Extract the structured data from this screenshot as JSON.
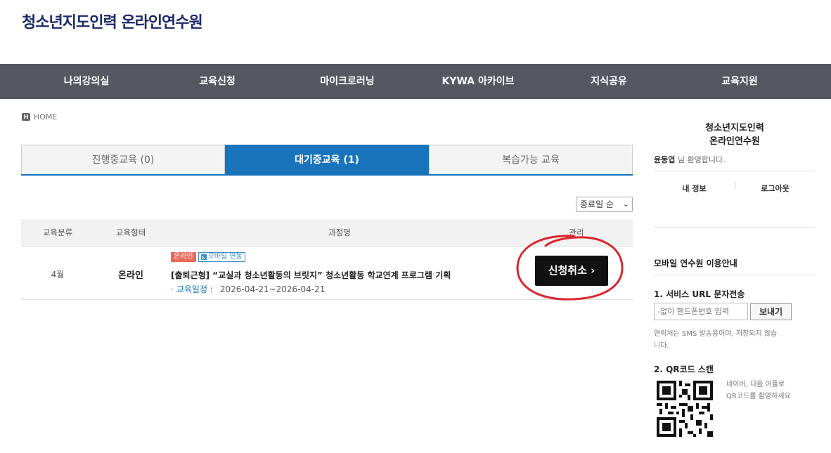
{
  "site": {
    "title": "청소년지도인력 온라인연수원"
  },
  "nav": [
    {
      "label": "나의강의실"
    },
    {
      "label": "교육신청"
    },
    {
      "label": "마이크로러닝"
    },
    {
      "label": "KYWA 아카이브"
    },
    {
      "label": "지식공유"
    },
    {
      "label": "교육지원"
    }
  ],
  "breadcrumb": {
    "icon_text": "H",
    "label": "HOME"
  },
  "tabs": [
    {
      "label": "진행중교육 (0)",
      "active": false
    },
    {
      "label": "대기중교육 (1)",
      "active": true
    },
    {
      "label": "복습가능 교육",
      "active": false
    }
  ],
  "sort": {
    "selected": "종료일 순"
  },
  "table": {
    "headers": [
      "교육분류",
      "교육형태",
      "과정명",
      "관리"
    ],
    "rows": [
      {
        "category": "4월",
        "type": "온라인",
        "badge_online": "온라인",
        "badge_mobile": "모바일 연동",
        "title": "[출퇴근형] “교실과 청소년활동의 브릿지” 청소년활동 학교연계 프로그램 기획",
        "schedule_label": "교육일정 :",
        "schedule_value": "2026-04-21~2026-04-21",
        "action_label": "신청취소 ›"
      }
    ]
  },
  "sidebar": {
    "title_line1": "청소년지도인력",
    "title_line2": "온라인연수원",
    "user_name": "윤동엽",
    "welcome_suffix": " 님 환영합니다.",
    "my_info": "내 정보",
    "logout": "로그아웃",
    "mobile_title": "모바일 연수원 이용안내",
    "service_title": "1. 서비스 URL 문자전송",
    "phone_placeholder": "-없이 핸드폰번호 입력",
    "send_label": "보내기",
    "sms_note": "연락처는 SMS 발송용이며, 저장되지 않습니다.",
    "qr_title": "2. QR코드 스캔",
    "qr_note": "네이버, 다음 어플로 QR코드를 촬영하세요."
  },
  "colors": {
    "nav_bg": "#555761",
    "accent": "#1a74bc",
    "title": "#1d2a6b",
    "annotation": "#d9262c"
  }
}
